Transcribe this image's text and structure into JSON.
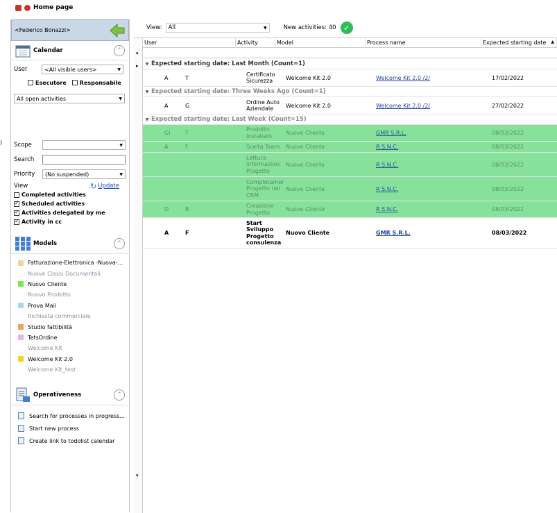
{
  "window": {
    "title": "Home page"
  },
  "stray_char": ")",
  "sidebar": {
    "user_name": "<Federico Bonazzi>",
    "calendar": {
      "label": "Calendar",
      "user_label": "User",
      "user_value": "<All visible users>",
      "esecutore": "Esecutore",
      "responsabile": "Responsabile",
      "activities_filter": "All open activities",
      "scope_label": "Scope",
      "scope_value": "",
      "search_label": "Search",
      "search_value": "",
      "priority_label": "Priority",
      "priority_value": "(No suspended)",
      "view_label": "View",
      "update_label": "Update",
      "checks": [
        {
          "label": "Completed activities",
          "checked": false
        },
        {
          "label": "Scheduled activities",
          "checked": true
        },
        {
          "label": "Activities delegated by me",
          "checked": true
        },
        {
          "label": "Activity in cc",
          "checked": true
        }
      ]
    },
    "models": {
      "label": "Models",
      "items": [
        {
          "label": "Fatturazione-Elettronica -Nuova-...",
          "color": "#f9cfa8",
          "dim": false
        },
        {
          "label": "Nuove Classi Documentali",
          "color": "",
          "dim": true
        },
        {
          "label": "Nuovo Cliente",
          "color": "#7ee84a",
          "dim": false
        },
        {
          "label": "Nuovo Prodotto",
          "color": "",
          "dim": true
        },
        {
          "label": "Prova Mail",
          "color": "#a8d8e8",
          "dim": false
        },
        {
          "label": "Richiesta commerciale",
          "color": "",
          "dim": true
        },
        {
          "label": "Studio fattibilità",
          "color": "#f4a05a",
          "dim": false
        },
        {
          "label": "TetsOrdine",
          "color": "#e3b6e8",
          "dim": false
        },
        {
          "label": "Welcome Kit",
          "color": "",
          "dim": true
        },
        {
          "label": "Welcome Kit 2.0",
          "color": "#f6d21a",
          "dim": false
        },
        {
          "label": "Welcome Kit_test",
          "color": "",
          "dim": true
        }
      ]
    },
    "operativeness": {
      "label": "Operativeness",
      "items": [
        {
          "label": "Search for processes in progress..."
        },
        {
          "label": "Start new process"
        },
        {
          "label": "Create link to todolist calendar"
        }
      ]
    }
  },
  "main": {
    "view_label": "View:",
    "view_value": "All",
    "new_activities": "New activities: 40",
    "columns": [
      "User",
      "Activity",
      "Model",
      "Process name",
      "Expected starting date"
    ],
    "groups": [
      {
        "title": "Expected starting date: Last Month (Count=1)",
        "faded": false,
        "rows": [
          {
            "u1": "A",
            "u2": "T",
            "activity": "Certificato Sicurezza",
            "model": "Welcome Kit 2.0",
            "process": "Welcome Kit 2.0 /2/",
            "date": "17/02/2022",
            "style": ""
          }
        ]
      },
      {
        "title": "Expected starting date: Three Weeks Ago (Count=1)",
        "faded": true,
        "rows": [
          {
            "u1": "A",
            "u2": "G",
            "activity": "Ordine Auto Aziendale",
            "model": "Welcome Kit 2.0",
            "process": "Welcome Kit 2.0 /2/",
            "date": "27/02/2022",
            "style": ""
          }
        ]
      },
      {
        "title": "Expected starting date: Last Week (Count=15)",
        "faded": true,
        "rows": [
          {
            "u1": "Gi",
            "u2": "T",
            "activity": "Prodotto Installato",
            "model": "Nuovo Cliente",
            "process": "GMR S.R.L.",
            "date": "08/03/2022",
            "style": "green"
          },
          {
            "u1": "A",
            "u2": "F",
            "activity": "Scelta Team",
            "model": "Nuovo Cliente",
            "process": "R S.N.C.",
            "date": "08/03/2022",
            "style": "green"
          },
          {
            "u1": "",
            "u2": "",
            "activity": "Lettura informazioni Progetto",
            "model": "Nuovo Cliente",
            "process": "R S.N.C.",
            "date": "08/03/2022",
            "style": "green"
          },
          {
            "u1": "",
            "u2": "",
            "activity": "Completamento Progetto nel CRM",
            "model": "Nuovo Cliente",
            "process": "R S.N.C.",
            "date": "08/03/2022",
            "style": "green"
          },
          {
            "u1": "D",
            "u2": "B",
            "activity": "Creazione Progetto",
            "model": "Nuovo Cliente",
            "process": "R S.N.C.",
            "date": "08/03/2022",
            "style": "green"
          },
          {
            "u1": "A",
            "u2": "F",
            "activity": "Start Sviluppo Progetto consulenza",
            "model": "Nuovo Cliente",
            "process": "GMR S.R.L.",
            "date": "08/03/2022",
            "style": "bold"
          }
        ]
      }
    ]
  }
}
